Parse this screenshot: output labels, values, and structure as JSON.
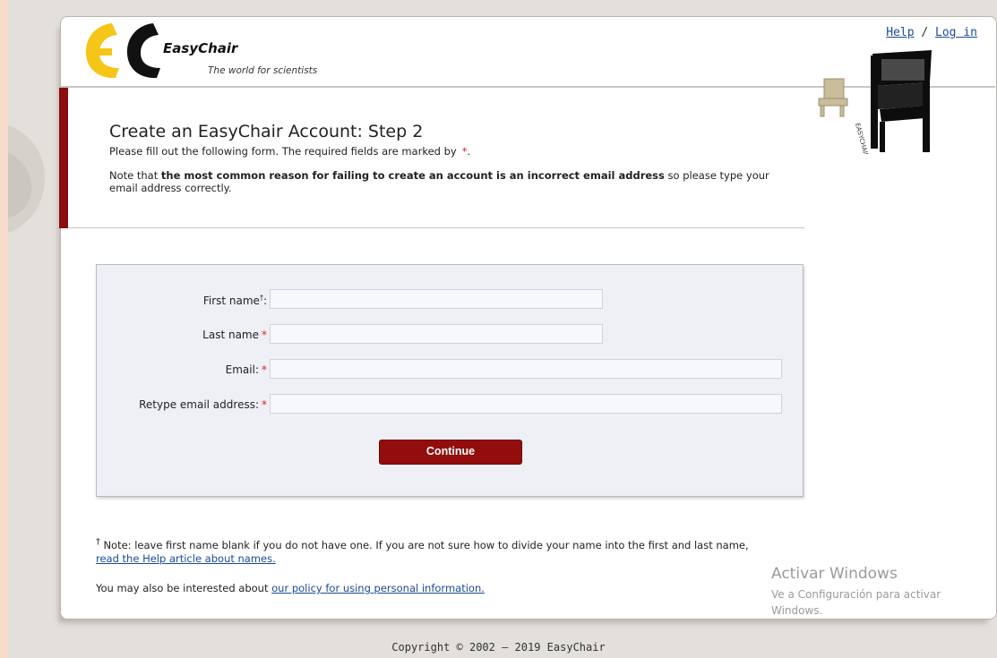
{
  "header": {
    "logo_name": "EasyChair",
    "logo_tagline": "The world for scientists",
    "help_link": "Help",
    "separator": "/",
    "login_link": "Log in"
  },
  "intro": {
    "title": "Create an EasyChair Account: Step 2",
    "required_note": "Please fill out the following form. The required fields are marked by",
    "required_star": "*",
    "required_end": ".",
    "warning_prefix": "Note that ",
    "warning_bold": "the most common reason for failing to create an account is an incorrect email address",
    "warning_suffix": " so please type your email address correctly."
  },
  "form": {
    "first_name_label": "First name",
    "first_name_dagger": "†",
    "first_name_colon": ":",
    "last_name_label": "Last name",
    "email_label": "Email:",
    "retype_label": "Retype email address:",
    "star": "*",
    "first_name_value": "",
    "last_name_value": "",
    "email_value": "",
    "retype_value": "",
    "continue_label": "Continue"
  },
  "footnote": {
    "dagger": "†",
    "text": " Note: leave first name blank if you do not have one. If you are not sure how to divide your name into the first and last name,",
    "link": "read the Help article about names."
  },
  "policy": {
    "prefix": "You may also be interested about ",
    "link": "our policy for using personal information."
  },
  "copyright": "Copyright © 2002 – 2019 EasyChair",
  "windows_watermark": {
    "title": "Activar Windows",
    "subtitle": "Ve a Configuración para activar Windows."
  },
  "colors": {
    "accent_red": "#930d0d",
    "link_blue": "#1a4a9a",
    "required_red": "#dd2222",
    "page_bg": "#e3dfda"
  }
}
